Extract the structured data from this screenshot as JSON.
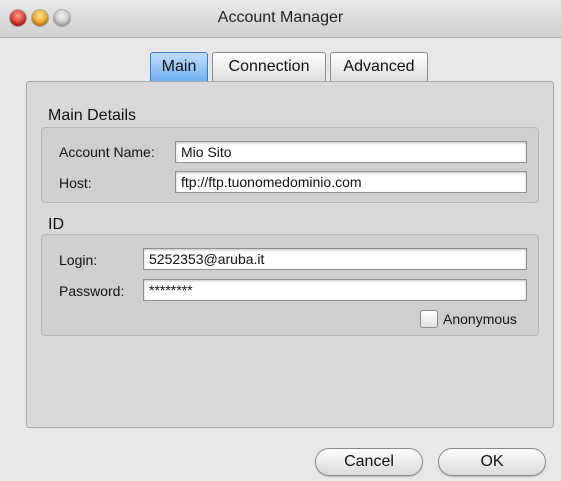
{
  "window": {
    "title": "Account Manager"
  },
  "tabs": [
    {
      "label": "Main",
      "active": true
    },
    {
      "label": "Connection",
      "active": false
    },
    {
      "label": "Advanced",
      "active": false
    }
  ],
  "main_details": {
    "section_label": "Main Details",
    "account_name_label": "Account Name:",
    "account_name_value": "Mio Sito",
    "host_label": "Host:",
    "host_value": "ftp://ftp.tuonomedominio.com"
  },
  "id_section": {
    "section_label": "ID",
    "login_label": "Login:",
    "login_value": "5252353@aruba.it",
    "password_label": "Password:",
    "password_value": "********",
    "anonymous_label": "Anonymous",
    "anonymous_checked": false
  },
  "buttons": {
    "cancel_label": "Cancel",
    "ok_label": "OK"
  },
  "colors": {
    "active_tab": "#6fb0f2",
    "close_light": "#d4261b",
    "minimize_light": "#e89a14"
  },
  "icons": [
    "close-window-icon",
    "minimize-window-icon",
    "zoom-window-icon"
  ]
}
